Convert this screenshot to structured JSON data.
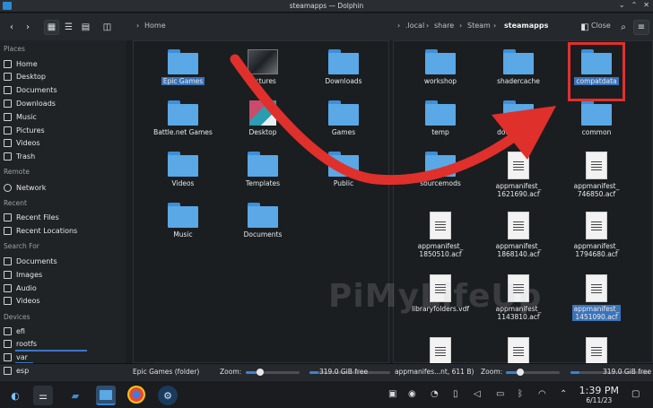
{
  "window": {
    "title": "steamapps — Dolphin"
  },
  "left_pane": {
    "breadcrumb": "Home",
    "items": [
      {
        "label": "Epic Games",
        "kind": "folder",
        "selected": true
      },
      {
        "label": "Pictures",
        "kind": "thumb"
      },
      {
        "label": "Downloads",
        "kind": "folder"
      },
      {
        "label": "Battle.net Games",
        "kind": "folder"
      },
      {
        "label": "Desktop",
        "kind": "color"
      },
      {
        "label": "Games",
        "kind": "folder"
      },
      {
        "label": "Videos",
        "kind": "folder"
      },
      {
        "label": "Templates",
        "kind": "folder"
      },
      {
        "label": "Public",
        "kind": "folder"
      },
      {
        "label": "Music",
        "kind": "folder"
      },
      {
        "label": "Documents",
        "kind": "folder"
      }
    ]
  },
  "right_pane": {
    "breadcrumb": [
      ".local",
      "share",
      "Steam",
      "steamapps"
    ],
    "close_label": "Close",
    "items": [
      {
        "label": "workshop",
        "kind": "folder"
      },
      {
        "label": "shadercache",
        "kind": "folder"
      },
      {
        "label": "compatdata",
        "kind": "folder",
        "selected": true
      },
      {
        "label": "temp",
        "kind": "folder"
      },
      {
        "label": "downloading",
        "kind": "folder"
      },
      {
        "label": "common",
        "kind": "folder"
      },
      {
        "label": "sourcemods",
        "kind": "folder"
      },
      {
        "label": "appmanifest_\n1621690.acf",
        "kind": "file"
      },
      {
        "label": "appmanifest_\n746850.acf",
        "kind": "file"
      },
      {
        "label": "appmanifest_\n1850510.acf",
        "kind": "file"
      },
      {
        "label": "appmanifest_\n1868140.acf",
        "kind": "file"
      },
      {
        "label": "appmanifest_\n1794680.acf",
        "kind": "file"
      },
      {
        "label": "libraryfolders.vdf",
        "kind": "file"
      },
      {
        "label": "appmanifest_\n1143810.acf",
        "kind": "file"
      },
      {
        "label": "appmanifest_\n1451090.acf",
        "kind": "file",
        "selected": true
      }
    ]
  },
  "sidebar": {
    "places_header": "Places",
    "places": [
      "Home",
      "Desktop",
      "Documents",
      "Downloads",
      "Music",
      "Pictures",
      "Videos",
      "Trash"
    ],
    "remote_header": "Remote",
    "remote": [
      "Network"
    ],
    "recent_header": "Recent",
    "recent": [
      "Recent Files",
      "Recent Locations"
    ],
    "search_header": "Search For",
    "search": [
      "Documents",
      "Images",
      "Audio",
      "Videos"
    ],
    "devices_header": "Devices",
    "devices": [
      {
        "label": "efi",
        "usage": 0
      },
      {
        "label": "rootfs",
        "usage": 0.6
      },
      {
        "label": "var",
        "usage": 0.15
      },
      {
        "label": "esp",
        "usage": 0
      }
    ]
  },
  "status_left": {
    "selection": "Epic Games (folder)",
    "zoom_label": "Zoom:",
    "zoom": 0.25,
    "free": "319.0 GiB free"
  },
  "status_right": {
    "selection": "appmanifes...nt, 611 B)",
    "zoom_label": "Zoom:",
    "zoom": 0.25,
    "free": "319.0 GiB free"
  },
  "taskbar": {
    "time": "1:39 PM",
    "date": "6/11/23"
  },
  "watermark": "PiMyLifeUp",
  "colors": {
    "accent": "#3b82d4",
    "folder": "#5aa8e6",
    "highlight": "#e0302c"
  }
}
